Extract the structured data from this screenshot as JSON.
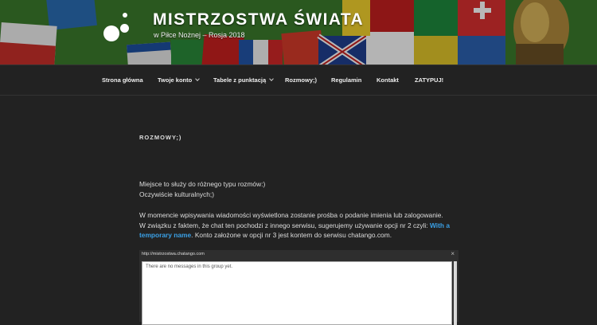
{
  "site": {
    "title": "MISTRZOSTWA ŚWIATA",
    "description": "w Piłce Nożnej – Rosja 2018"
  },
  "nav": {
    "items": [
      {
        "label": "Strona główna",
        "dropdown": false
      },
      {
        "label": "Twoje konto",
        "dropdown": true
      },
      {
        "label": "Tabele z punktacją",
        "dropdown": true
      },
      {
        "label": "Rozmowy;)",
        "dropdown": false
      },
      {
        "label": "Regulamin",
        "dropdown": false
      },
      {
        "label": "Kontakt",
        "dropdown": false
      },
      {
        "label": "ZATYPUJ!",
        "dropdown": false
      }
    ]
  },
  "page": {
    "title": "ROZMOWY;)",
    "p1_line1": "Miejsce to służy do różnego typu rozmów:)",
    "p1_line2": "Oczywiście kulturalnych;)",
    "p2_line1": "W momencie wpisywania wiadomości wyświetlona zostanie prośba o podanie imienia lub zalogowanie.",
    "p2_line2_pre": "W związku z faktem, że chat ten pochodzi z innego serwisu, sugerujemy używanie opcji nr 2 czyli: ",
    "p2_link_part1": "With a",
    "p2_link_part2": "temporary name",
    "p2_line3_post": ". Konto założone w opcji nr 3 jest kontem do serwisu chatango.com."
  },
  "chat": {
    "url": "http://mistrzostwa.chatango.com",
    "close": "×",
    "empty_message": "There are no messages in this group yet."
  },
  "colors": {
    "background": "#222222",
    "link": "#3aa0e6"
  }
}
